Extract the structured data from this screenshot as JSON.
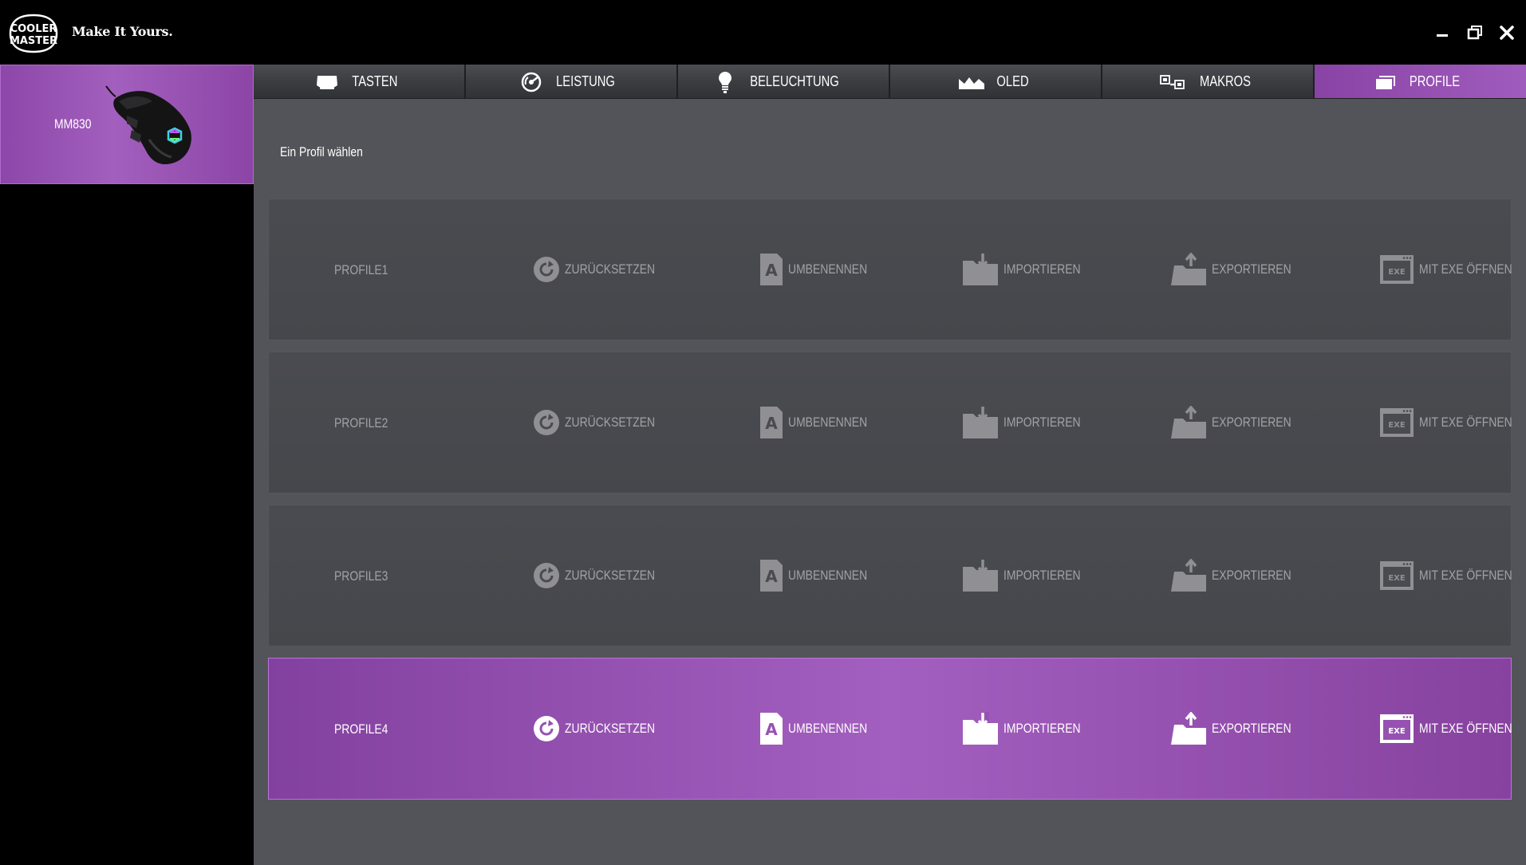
{
  "app": {
    "brand_line1": "COOLER",
    "brand_line2": "MASTER",
    "tagline": "Make It Yours."
  },
  "device": {
    "name": "MM830"
  },
  "tabs": [
    {
      "label": "TASTEN",
      "icon": "keyboard-icon"
    },
    {
      "label": "LEISTUNG",
      "icon": "gauge-icon"
    },
    {
      "label": "BELEUCHTUNG",
      "icon": "lightbulb-icon"
    },
    {
      "label": "OLED",
      "icon": "oled-display-icon"
    },
    {
      "label": "MAKROS",
      "icon": "macro-icon"
    },
    {
      "label": "PROFILE",
      "icon": "profile-icon",
      "active": true
    }
  ],
  "section_title": "Ein Profil wählen",
  "actions": {
    "reset": "ZURÜCKSETZEN",
    "rename": "UMBENENNEN",
    "import": "IMPORTIEREN",
    "export": "EXPORTIEREN",
    "exe": "MIT EXE ÖFFNEN",
    "exe_badge": "EXE",
    "rename_glyph": "A"
  },
  "profiles": [
    {
      "name": "PROFILE1",
      "active": false
    },
    {
      "name": "PROFILE2",
      "active": false
    },
    {
      "name": "PROFILE3",
      "active": false
    },
    {
      "name": "PROFILE4",
      "active": true
    }
  ],
  "colors": {
    "accent": "#9a56b8",
    "background": "#000000",
    "panel": "#535459",
    "row": "#48494e",
    "inactive_text": "#a2a2a6"
  }
}
